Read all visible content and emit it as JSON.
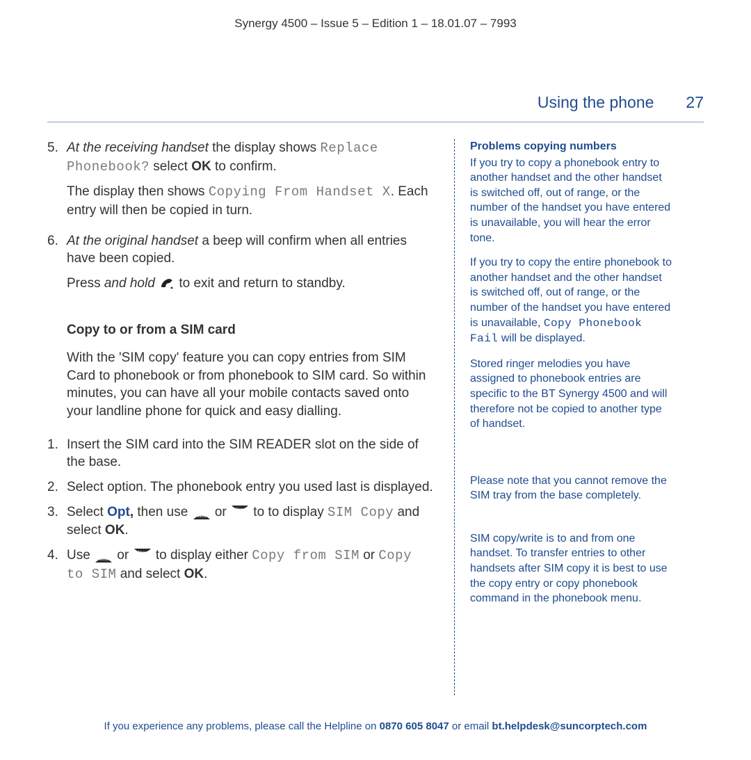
{
  "doc_header": "Synergy 4500 – Issue 5 –  Edition 1 – 18.01.07 – 7993",
  "section_title": "Using the phone",
  "page_number": "27",
  "main": {
    "step5": {
      "num": "5.",
      "pre_italic": "At the receiving handset",
      "after_italic": " the display shows ",
      "lcd1": "Replace Phonebook?",
      "tail1": " select ",
      "ok": "OK",
      "tail2": " to confirm.",
      "cont_pre": "The display then shows ",
      "cont_lcd": "Copying From Handset X",
      "cont_post": ". Each entry will then be copied in turn."
    },
    "step6": {
      "num": "6.",
      "pre_italic": "At the original handset",
      "after_italic": " a beep will confirm when all entries have been copied.",
      "cont_pre": "Press ",
      "cont_italic": "and hold",
      "cont_post": " to exit and return to standby."
    },
    "sim_head": "Copy to or from a SIM card",
    "sim_intro": "With the 'SIM copy' feature you can copy entries from SIM Card to phonebook or from phonebook to SIM card. So within minutes, you can have all your mobile contacts saved onto your landline phone for quick and easy dialling.",
    "sim1": {
      "num": "1.",
      "text": "Insert the SIM card into the SIM READER slot on the side of the base."
    },
    "sim2": {
      "num": "2.",
      "text": "Select        option. The phonebook entry you used last is displayed."
    },
    "sim3": {
      "num": "3.",
      "pre": "Select ",
      "opt": "Opt",
      "comma": ",",
      "mid1": " then use ",
      "mid2": " or ",
      "mid3": " to to display ",
      "lcd": "SIM Copy",
      "tail": " and select ",
      "ok": "OK",
      "dot": "."
    },
    "sim4": {
      "num": "4.",
      "pre": "Use ",
      "mid1": " or ",
      "mid2": " to display either ",
      "lcd1": "Copy from SIM",
      "mid3": " or ",
      "lcd2": "Copy to SIM",
      "tail": " and select ",
      "ok": "OK",
      "dot": "."
    }
  },
  "side": {
    "head": "Problems copying numbers",
    "p1": "If you try to copy a phonebook entry to another handset and the other handset is switched off, out of range, or the number of the handset you have entered is unavailable, you will hear the error tone.",
    "p2_pre": "If you try to copy the entire phonebook to another handset and the other handset is switched off, out of range, or the number of the handset you have entered is unavailable, ",
    "p2_lcd": "Copy Phonebook Fail",
    "p2_post": " will be displayed.",
    "p3": "Stored ringer melodies you have assigned to phonebook entries are specific to the BT Synergy 4500 and will therefore not be copied to another type of handset.",
    "p4": "Please note that you cannot remove the SIM tray from the base completely.",
    "p5": "SIM copy/write is to and from one handset. To transfer entries to other handsets after SIM copy it is best to use the copy entry or copy phonebook command in the phonebook menu."
  },
  "footer": {
    "pre": "If you experience any problems, please call the Helpline on ",
    "phone": "0870 605 8047",
    "mid": " or email ",
    "email": "bt.helpdesk@suncorptech.com"
  }
}
